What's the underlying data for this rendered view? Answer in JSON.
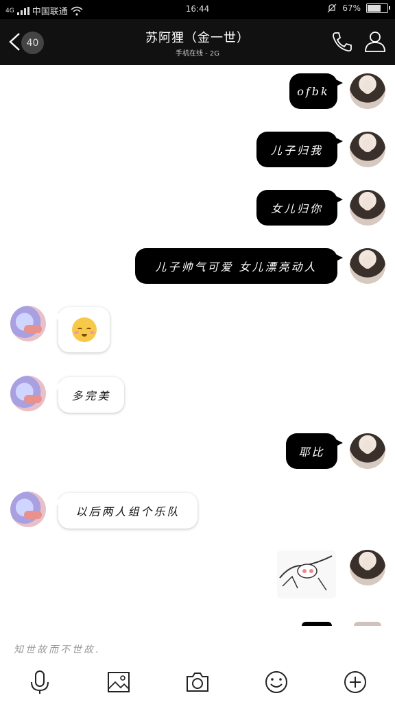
{
  "status_bar": {
    "signal": "4G",
    "carrier": "中国联通",
    "time": "16:44",
    "battery": "67%",
    "battery_level": 0.67
  },
  "header": {
    "unread_count": "40",
    "contact_name": "苏阿狸（金一世）",
    "status": "手机在线 - 2G"
  },
  "messages": [
    {
      "side": "me",
      "text": "ofbk"
    },
    {
      "side": "me",
      "text": "儿子归我"
    },
    {
      "side": "me",
      "text": "女儿归你"
    },
    {
      "side": "me",
      "text": "儿子帅气可爱 女儿漂亮动人"
    },
    {
      "side": "other",
      "type": "emoji",
      "text": "pleading-face-emoji"
    },
    {
      "side": "other",
      "text": "多完美"
    },
    {
      "side": "me",
      "text": "耶比"
    },
    {
      "side": "other",
      "text": "以后两人组个乐队"
    },
    {
      "side": "me",
      "type": "sticker",
      "text": "sticker-image"
    }
  ],
  "input": {
    "placeholder": "知世故而不世故."
  },
  "toolbar": {
    "icons": [
      "microphone-icon",
      "image-icon",
      "camera-icon",
      "emoji-icon",
      "plus-icon"
    ]
  }
}
